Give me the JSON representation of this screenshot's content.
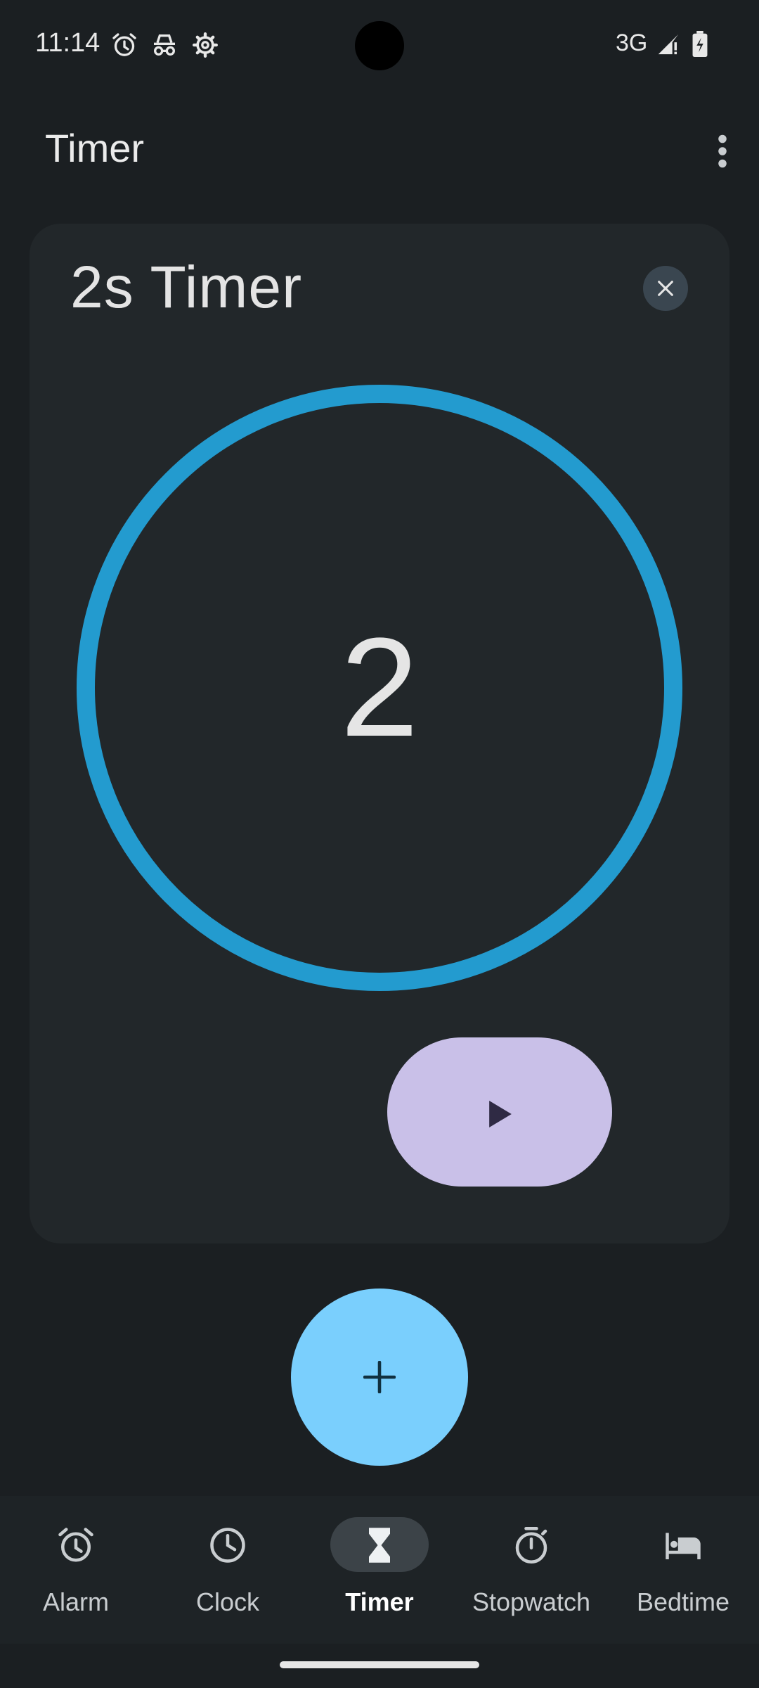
{
  "status_bar": {
    "time": "11:14",
    "icons": [
      "alarm-icon",
      "incognito-icon",
      "settings-gear-icon"
    ],
    "network": "3G",
    "right_icons": [
      "signal-icon",
      "battery-charging-icon"
    ]
  },
  "app_bar": {
    "title": "Timer",
    "menu_icon": "more-vert-icon"
  },
  "timer_card": {
    "label": "2s Timer",
    "remaining": "2",
    "progress_fraction": 1.0,
    "ring_color": "#239bcf",
    "close_icon": "close-icon",
    "play_icon": "play-icon"
  },
  "fab": {
    "icon": "add-icon"
  },
  "bottom_nav": {
    "items": [
      {
        "label": "Alarm",
        "icon": "alarm-icon",
        "active": false
      },
      {
        "label": "Clock",
        "icon": "clock-icon",
        "active": false
      },
      {
        "label": "Timer",
        "icon": "hourglass-icon",
        "active": true
      },
      {
        "label": "Stopwatch",
        "icon": "stopwatch-icon",
        "active": false
      },
      {
        "label": "Bedtime",
        "icon": "bed-icon",
        "active": false
      }
    ]
  },
  "colors": {
    "background": "#1b1f22",
    "card": "#22272a",
    "play_button": "#c9c0e8",
    "fab": "#7acffd",
    "active_pill": "#3c4348"
  }
}
